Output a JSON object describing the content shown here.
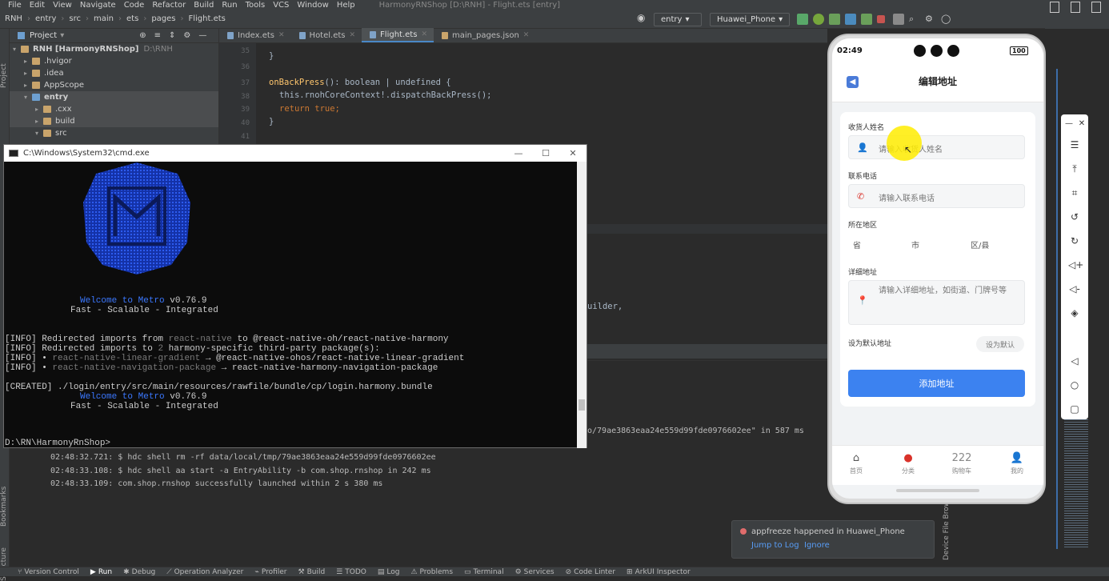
{
  "window": {
    "title": "HarmonyRNShop [D:\\RNH] - Flight.ets [entry]"
  },
  "menu": [
    "File",
    "Edit",
    "View",
    "Navigate",
    "Code",
    "Refactor",
    "Build",
    "Run",
    "Tools",
    "VCS",
    "Window",
    "Help"
  ],
  "breadcrumb": [
    "RNH",
    "entry",
    "src",
    "main",
    "ets",
    "pages",
    "Flight.ets"
  ],
  "toolbar": {
    "module": "entry",
    "device": "Huawei_Phone"
  },
  "project": {
    "header": "Project",
    "root": "RNH [HarmonyRNShop]",
    "root_path": "D:\\RNH",
    "items": [
      ".hvigor",
      ".idea",
      "AppScope",
      "entry",
      ".cxx",
      "build",
      "src"
    ]
  },
  "tabs": [
    "Index.ets",
    "Hotel.ets",
    "Flight.ets",
    "main_pages.json"
  ],
  "editor": {
    "line_numbers": [
      "35",
      "36",
      "37",
      "38",
      "39",
      "40",
      "41"
    ],
    "code": {
      "l35": "}",
      "l37_name": "onBackPress",
      "l37_rest": "(): boolean | undefined {",
      "l38": "this.rnohCoreContext!.dispatchBackPress();",
      "l39_kw": "return",
      "l39_val": "true;",
      "l40": "}"
    },
    "fragment_builder": "uilder,",
    "fragment_ms": "o/79ae3863eaa24e559d99fde0976602ee\" in 587 ms"
  },
  "cmd": {
    "title": "C:\\Windows\\System32\\cmd.exe",
    "welcome_pre": "Welcome to",
    "welcome_metro": "Metro",
    "version": "v0.76.9",
    "tagline": "Fast - Scalable - Integrated",
    "info1_a": "[INFO] Redirected imports from",
    "info1_b": "react-native",
    "info1_c": "to @react-native-oh/react-native-harmony",
    "info2_a": "[INFO] Redirected imports to",
    "info2_b": "2",
    "info2_c": "harmony-specific third-party package(s):",
    "info3_a": "[INFO] •",
    "info3_b": "react-native-linear-gradient",
    "info3_c": "→ @react-native-ohos/react-native-linear-gradient",
    "info4_a": "[INFO] •",
    "info4_b": "react-native-navigation-package",
    "info4_c": "→ react-native-harmony-navigation-package",
    "created": "[CREATED] ./login/entry/src/main/resources/rawfile/bundle/cp/login.harmony.bundle",
    "prompt": "D:\\RN\\HarmonyRnShop>"
  },
  "run_log": [
    "02:48:32.721: $ hdc shell rm -rf data/local/tmp/79ae3863eaa24e559d99fde0976602ee",
    "02:48:33.108: $ hdc shell aa start -a EntryAbility -b com.shop.rnshop in 242 ms",
    "02:48:33.109: com.shop.rnshop successfully launched within 2 s 380 ms"
  ],
  "phone": {
    "time": "02:49",
    "battery": "100",
    "page_title": "编辑地址",
    "name_label": "收货人姓名",
    "name_placeholder": "请输入收货人姓名",
    "phone_label": "联系电话",
    "phone_placeholder": "请输入联系电话",
    "region_label": "所在地区",
    "province": "省",
    "city": "市",
    "district": "区/县",
    "detail_label": "详细地址",
    "detail_placeholder": "请输入详细地址，如街道、门牌号等",
    "default_label": "设为默认地址",
    "default_button": "设为默认",
    "add_button": "添加地址",
    "tabs": [
      {
        "label": "首页",
        "icon": "home-icon"
      },
      {
        "label": "分类",
        "icon": "pin-icon"
      },
      {
        "label": "购物车",
        "icon": "cart-count",
        "value": "222"
      },
      {
        "label": "我的",
        "icon": "user-icon"
      }
    ],
    "accent": "#3c82f0"
  },
  "notification": {
    "text": "appfreeze happened in Huawei_Phone",
    "jump": "Jump to Log",
    "ignore": "Ignore"
  },
  "side_labels": {
    "project": "Project",
    "bookmarks": "Bookmarks",
    "structure": "Structure",
    "device_file_browser": "Device File Browser"
  },
  "statusbar": [
    "Version Control",
    "Run",
    "Debug",
    "Operation Analyzer",
    "Profiler",
    "Build",
    "TODO",
    "Log",
    "Problems",
    "Terminal",
    "Services",
    "Code Linter",
    "ArkUI Inspector"
  ]
}
